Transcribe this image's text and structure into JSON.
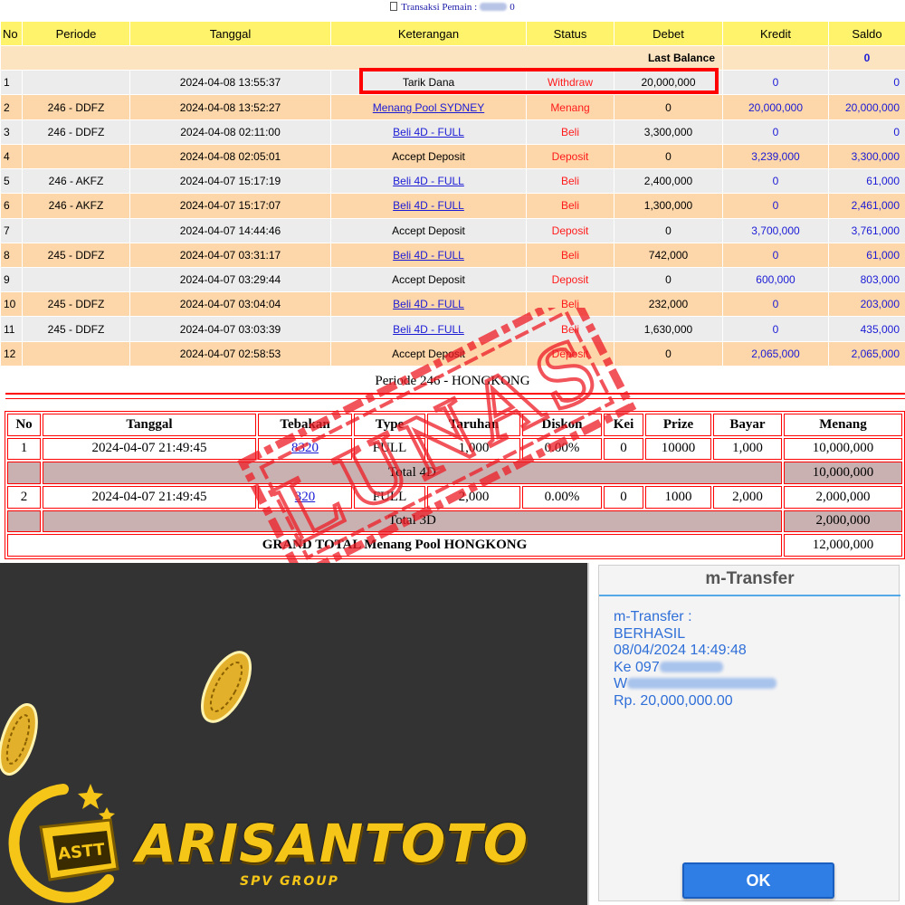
{
  "caption": {
    "label": "Transaksi  Pemain :",
    "suffix": "0"
  },
  "transactions": {
    "headers": [
      "No",
      "Periode",
      "Tanggal",
      "Keterangan",
      "Status",
      "Debet",
      "Kredit",
      "Saldo"
    ],
    "last_balance_label": "Last Balance",
    "last_balance_value": "0",
    "rows": [
      {
        "no": "1",
        "periode": "",
        "tanggal": "2024-04-08 13:55:37",
        "keterangan": "Tarik Dana",
        "link": false,
        "status": "Withdraw",
        "debet": "20,000,000",
        "kredit": "0",
        "saldo": "0"
      },
      {
        "no": "2",
        "periode": "246 - DDFZ",
        "tanggal": "2024-04-08 13:52:27",
        "keterangan": "Menang Pool SYDNEY",
        "link": true,
        "status": "Menang",
        "debet": "0",
        "kredit": "20,000,000",
        "saldo": "20,000,000"
      },
      {
        "no": "3",
        "periode": "246 - DDFZ",
        "tanggal": "2024-04-08 02:11:00",
        "keterangan": "Beli 4D - FULL",
        "link": true,
        "status": "Beli",
        "debet": "3,300,000",
        "kredit": "0",
        "saldo": "0"
      },
      {
        "no": "4",
        "periode": "",
        "tanggal": "2024-04-08 02:05:01",
        "keterangan": "Accept Deposit",
        "link": false,
        "status": "Deposit",
        "debet": "0",
        "kredit": "3,239,000",
        "saldo": "3,300,000"
      },
      {
        "no": "5",
        "periode": "246 - AKFZ",
        "tanggal": "2024-04-07 15:17:19",
        "keterangan": "Beli 4D - FULL",
        "link": true,
        "status": "Beli",
        "debet": "2,400,000",
        "kredit": "0",
        "saldo": "61,000"
      },
      {
        "no": "6",
        "periode": "246 - AKFZ",
        "tanggal": "2024-04-07 15:17:07",
        "keterangan": "Beli 4D - FULL",
        "link": true,
        "status": "Beli",
        "debet": "1,300,000",
        "kredit": "0",
        "saldo": "2,461,000"
      },
      {
        "no": "7",
        "periode": "",
        "tanggal": "2024-04-07 14:44:46",
        "keterangan": "Accept Deposit",
        "link": false,
        "status": "Deposit",
        "debet": "0",
        "kredit": "3,700,000",
        "saldo": "3,761,000"
      },
      {
        "no": "8",
        "periode": "245 - DDFZ",
        "tanggal": "2024-04-07 03:31:17",
        "keterangan": "Beli 4D - FULL",
        "link": true,
        "status": "Beli",
        "debet": "742,000",
        "kredit": "0",
        "saldo": "61,000"
      },
      {
        "no": "9",
        "periode": "",
        "tanggal": "2024-04-07 03:29:44",
        "keterangan": "Accept Deposit",
        "link": false,
        "status": "Deposit",
        "debet": "0",
        "kredit": "600,000",
        "saldo": "803,000"
      },
      {
        "no": "10",
        "periode": "245 - DDFZ",
        "tanggal": "2024-04-07 03:04:04",
        "keterangan": "Beli 4D - FULL",
        "link": true,
        "status": "Beli",
        "debet": "232,000",
        "kredit": "0",
        "saldo": "203,000"
      },
      {
        "no": "11",
        "periode": "245 - DDFZ",
        "tanggal": "2024-04-07 03:03:39",
        "keterangan": "Beli 4D - FULL",
        "link": true,
        "status": "Beli",
        "debet": "1,630,000",
        "kredit": "0",
        "saldo": "435,000"
      },
      {
        "no": "12",
        "periode": "",
        "tanggal": "2024-04-07 02:58:53",
        "keterangan": "Accept Deposit",
        "link": false,
        "status": "Deposit",
        "debet": "0",
        "kredit": "2,065,000",
        "saldo": "2,065,000"
      }
    ]
  },
  "periode": {
    "title": "Periode 246 - HONGKONG",
    "headers": [
      "No",
      "Tanggal",
      "Tebakan",
      "Type",
      "Taruhan",
      "Diskon",
      "Kei",
      "Prize",
      "Bayar",
      "Menang"
    ],
    "bets": [
      {
        "no": "1",
        "tanggal": "2024-04-07 21:49:45",
        "tebakan": "8320",
        "type": "FULL",
        "taruhan": "1,000",
        "diskon": "0.00%",
        "kei": "0",
        "prize": "10000",
        "bayar": "1,000",
        "menang": "10,000,000",
        "subtotal_label": "Total 4D",
        "subtotal": "10,000,000"
      },
      {
        "no": "2",
        "tanggal": "2024-04-07 21:49:45",
        "tebakan": "320",
        "type": "FULL",
        "taruhan": "2,000",
        "diskon": "0.00%",
        "kei": "0",
        "prize": "1000",
        "bayar": "2,000",
        "menang": "2,000,000",
        "subtotal_label": "Total 3D",
        "subtotal": "2,000,000"
      }
    ],
    "grand_total_label": "GRAND TOTAL  Menang Pool HONGKONG",
    "grand_total": "12,000,000"
  },
  "stamp": {
    "text": "LUNAS",
    "color": "#ee1c25"
  },
  "brand": {
    "name": "ARISANTOTO",
    "sub": "SPV GROUP",
    "logo_text": "ASTT",
    "color": "#f5c518"
  },
  "mtransfer": {
    "title": "m-Transfer",
    "line1": "m-Transfer :",
    "line2": "BERHASIL",
    "line3": "08/04/2024 14:49:48",
    "line4_prefix": "Ke 097",
    "line5_prefix": "W",
    "line6": "Rp. 20,000,000.00",
    "ok_label": "OK"
  },
  "colors": {
    "header_yellow": "#fff36b",
    "row_orange": "#fdd6a9",
    "row_gray": "#ececec",
    "status_red": "#ff1b1b",
    "link_blue": "#1b1bd6",
    "highlight_red": "#ff0000"
  }
}
